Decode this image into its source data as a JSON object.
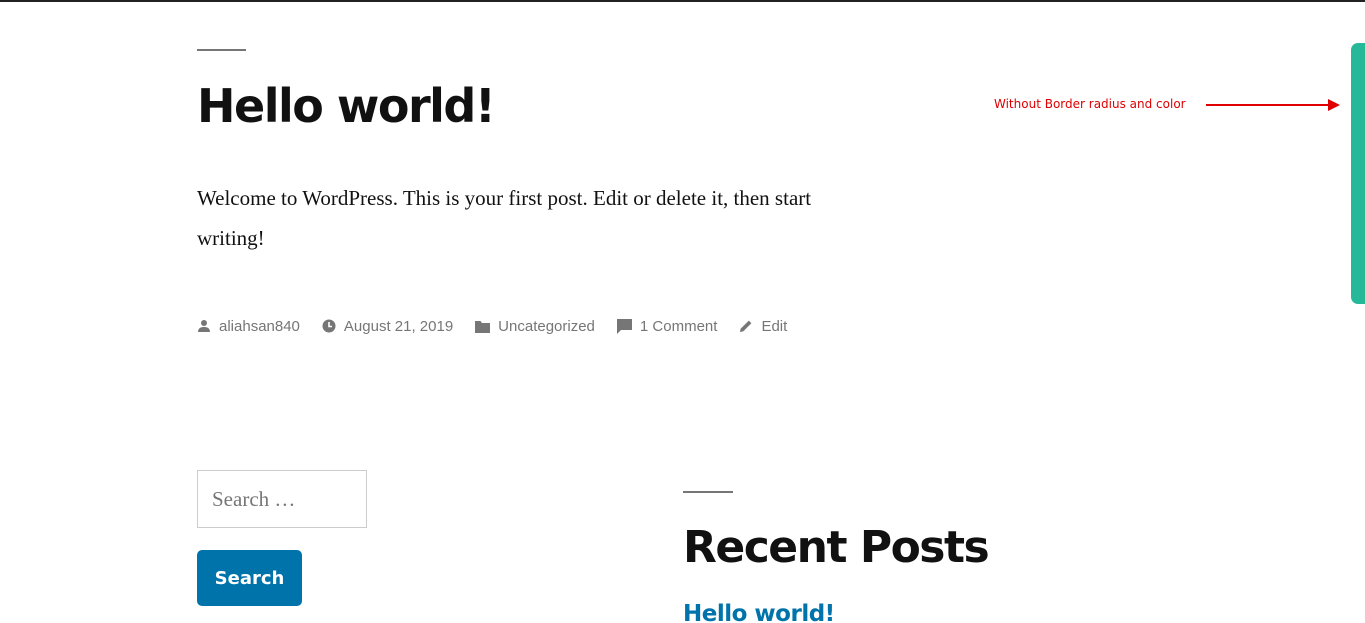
{
  "post": {
    "title": "Hello world!",
    "content": "Welcome to WordPress. This is your first post. Edit or delete it, then start writing!",
    "meta": {
      "author": "aliahsan840",
      "date": "August 21, 2019",
      "category": "Uncategorized",
      "comments": "1 Comment",
      "edit": "Edit"
    }
  },
  "annotation": {
    "text": "Without Border radius and color",
    "color": "#e00000"
  },
  "search": {
    "placeholder": "Search …",
    "button_label": "Search"
  },
  "recent_posts": {
    "title": "Recent Posts",
    "items": [
      {
        "label": "Hello world!"
      }
    ]
  },
  "colors": {
    "accent": "#0073aa",
    "scrollbar": "#26b999",
    "meta_text": "#767676"
  },
  "icons": [
    "person-icon",
    "clock-icon",
    "folder-icon",
    "comment-icon",
    "edit-pencil-icon",
    "arrow-right-icon"
  ]
}
